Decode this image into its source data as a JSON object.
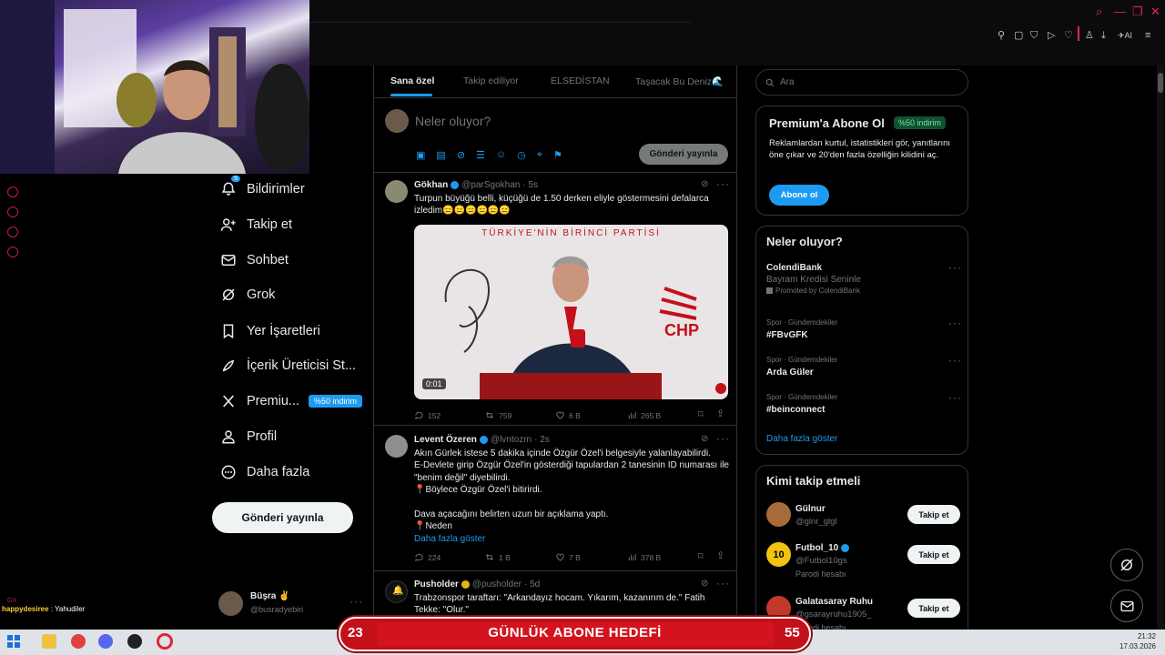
{
  "feed": {
    "tabs": [
      "Sana özel",
      "Takip ediliyor",
      "ELSEDİSTAN",
      "Taşacak Bu Deniz🌊"
    ],
    "compose_placeholder": "Neler oluyor?",
    "compose_button": "Gönderi yayınla",
    "tweets": [
      {
        "name": "Gökhan",
        "handle": "@parSgokhan",
        "time": "· 5s",
        "text": "Turpun büyüğü belli, küçüğü de 1.50 derken eliyle göstermesini defalarca izledim😑😑😑😑😑😑",
        "video_time": "0:01",
        "video_caption": "TÜRKİYE'NİN BİRİNCİ PARTİSİ",
        "video_logo": "CHP",
        "replies": "152",
        "reposts": "759",
        "likes": "6 B",
        "views": "265 B"
      },
      {
        "name": "Levent Özeren",
        "handle": "@lvntozrn",
        "time": "· 2s",
        "lines": [
          "Akın Gürlek istese 5 dakika içinde Özgür Özel'i belgesiyle yalanlayabilirdi.",
          "E-Devlete girip Özgür Özel'in gösterdiği tapulardan 2 tanesinin ID numarası ile \"benim değil\" diyebilirdi.",
          "📍Böylece Özgür Özel'i bitirirdi.",
          "",
          "Dava açacağını belirten uzun bir açıklama yaptı.",
          "📍Neden"
        ],
        "more": "Daha fazla göster",
        "replies": "224",
        "reposts": "1 B",
        "likes": "7 B",
        "views": "378 B"
      },
      {
        "name": "Pusholder",
        "handle": "@pusholder",
        "time": "· 5d",
        "text": "Trabzonspor taraftarı: \"Arkandayız hocam. Yıkarım, kazanırım de.\" Fatih Tekke: \"Olur.\""
      }
    ]
  },
  "nav": {
    "items": [
      {
        "label": "Bildirimler",
        "badge": "5"
      },
      {
        "label": "Takip et"
      },
      {
        "label": "Sohbet"
      },
      {
        "label": "Grok"
      },
      {
        "label": "Yer İşaretleri"
      },
      {
        "label": "İçerik Üreticisi St..."
      },
      {
        "label": "Premiu...",
        "pill": "%50 indirim"
      },
      {
        "label": "Profil"
      },
      {
        "label": "Daha fazla"
      }
    ],
    "post_button": "Gönderi yayınla",
    "user_name": "Büşra ✌",
    "user_handle": "@busradyebiri"
  },
  "right": {
    "search_placeholder": "Ara",
    "premium": {
      "title": "Premium'a Abone Ol",
      "badge": "%50 indirim",
      "text": "Reklamlardan kurtul, istatistikleri gör, yanıtlarını öne çıkar ve 20'den fazla özelliğin kilidini aç.",
      "button": "Abone ol"
    },
    "trends": {
      "title": "Neler oluyor?",
      "items": [
        {
          "name": "ColendiBank",
          "sub": "Bayram Kredisi Seninle",
          "meta": "Promoted by ColendiBank"
        },
        {
          "meta": "Spor · Gündemdekiler",
          "name": "#FBvGFK"
        },
        {
          "meta": "Spor · Gündemdekiler",
          "name": "Arda Güler"
        },
        {
          "meta": "Spor · Gündemdekiler",
          "name": "#beinconnect"
        }
      ],
      "more": "Daha fazla göster"
    },
    "who_to_follow": {
      "title": "Kimi takip etmeli",
      "users": [
        {
          "name": "Gülnur",
          "handle": "@glnr_glgl",
          "button": "Takip et"
        },
        {
          "name": "Futbol_10",
          "handle": "@Futbol10gs",
          "note": "Parodi hesabı",
          "button": "Takip et"
        },
        {
          "name": "Galatasaray Ruhu",
          "handle": "@gsarayruhu1905_",
          "note": "Parodi hesabı",
          "button": "Takip et"
        }
      ]
    }
  },
  "overlay": {
    "banner_left": "23",
    "banner_title": "GÜNLÜK ABONE HEDEFİ",
    "banner_right": "55",
    "chat_user": "happydesiree",
    "chat_text": "Yahudiler",
    "chat_tag": "GX"
  },
  "taskbar": {
    "time": "21:32",
    "date": "17.03.2026"
  },
  "colors": {
    "accent": "#1d9bf0",
    "banner": "#c4101a",
    "premium_badge": "#0f5132"
  }
}
